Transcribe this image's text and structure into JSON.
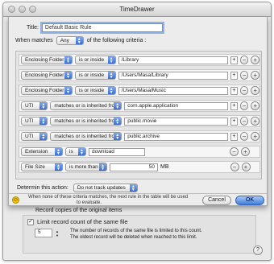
{
  "window": {
    "title": "TimeDrawer"
  },
  "sheet": {
    "title_label": "Title:",
    "title_value": "Default Basic Rule",
    "when_matches_label": "When matches",
    "match_mode": "Any",
    "match_suffix": "of the following criteria :",
    "criteria": [
      {
        "field": "Enclosing Folder",
        "operator": "is or inside",
        "value": "/Library"
      },
      {
        "field": "Enclosing Folder",
        "operator": "is or inside",
        "value": "/Users/Masa/Library"
      },
      {
        "field": "Enclosing Folder",
        "operator": "is or inside",
        "value": "/Users/Masa/Music"
      },
      {
        "field": "UTI",
        "operator": "matches or is inherited from",
        "value": "com.apple.application"
      },
      {
        "field": "UTI",
        "operator": "matches or is inherited from",
        "value": "public.movie"
      },
      {
        "field": "UTI",
        "operator": "matches or is inherited from",
        "value": "public.archive"
      },
      {
        "field": "Extension",
        "operator": "is",
        "value": "download"
      },
      {
        "field": "File Size",
        "operator": "is more than",
        "value": "50",
        "unit": "MB"
      }
    ],
    "action_label": "Determin this action:",
    "action_value": "Do not track updates",
    "footnote_line1": "When none of these criteria matches, the next rule in the table will be used",
    "footnote_line2": "to evaluate.",
    "cancel_label": "Cancel",
    "ok_label": "OK"
  },
  "background": {
    "record_copies_text": "Record copies of the original items",
    "limit_label": "Limit record count of the same file",
    "limit_checked": "✓",
    "limit_value": "5",
    "limit_desc_line1": "The number of records of the same file is limited to this count.",
    "limit_desc_line2": "The oldest record will be deleted when reached to this limit.",
    "help_label": "?"
  },
  "icons": {
    "add": "+",
    "remove": "−",
    "popup_arrows": "▲▼",
    "smiley": "☺"
  }
}
